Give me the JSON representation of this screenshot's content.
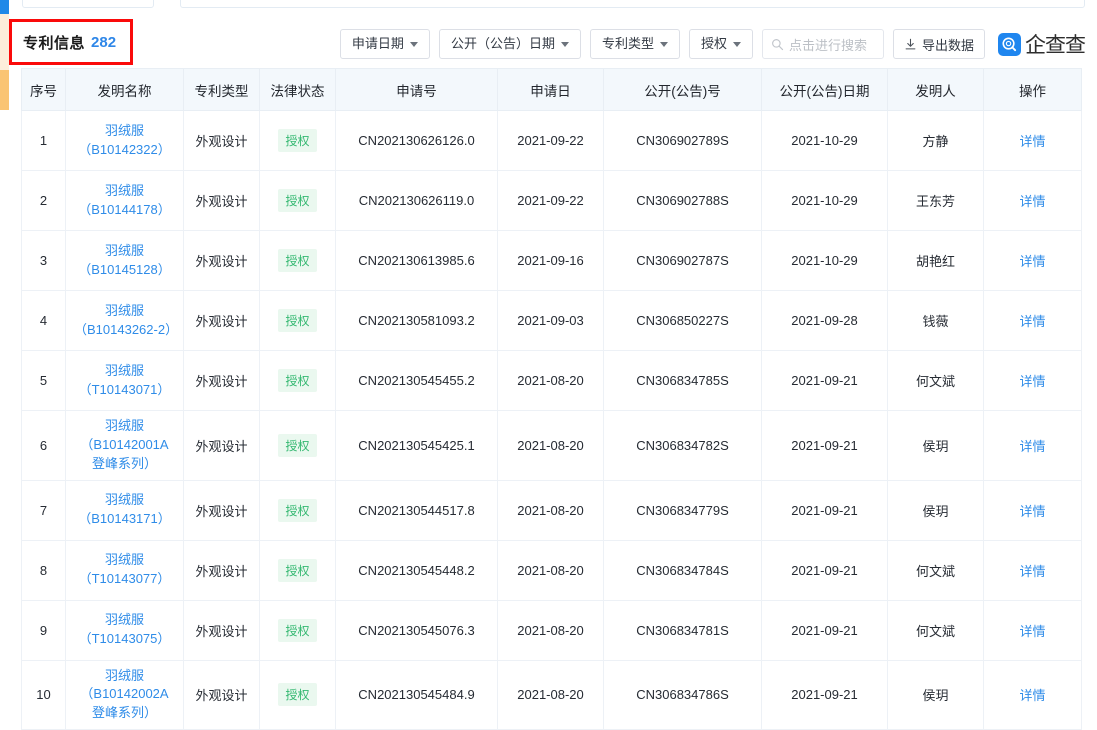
{
  "header": {
    "title_label": "专利信息",
    "count": "282"
  },
  "toolbar": {
    "filters": [
      {
        "label": "申请日期",
        "icon": "chevron-down-icon"
      },
      {
        "label": "公开（公告）日期",
        "icon": "chevron-down-icon"
      },
      {
        "label": "专利类型",
        "icon": "chevron-down-icon"
      },
      {
        "label": "授权",
        "icon": "chevron-down-icon"
      }
    ],
    "search": {
      "placeholder": "点击进行搜索",
      "icon": "search-icon"
    },
    "export": {
      "label": "导出数据",
      "icon": "download-icon"
    },
    "brand": {
      "name": "企查查",
      "icon": "qcc-logo-icon",
      "color": "#1f86ef"
    }
  },
  "table": {
    "columns": [
      "序号",
      "发明名称",
      "专利类型",
      "法律状态",
      "申请号",
      "申请日",
      "公开(公告)号",
      "公开(公告)日期",
      "发明人",
      "操作"
    ],
    "action_label": "详情",
    "rows": [
      {
        "seq": "1",
        "name": "羽绒服（B10142322）",
        "type": "外观设计",
        "status": "授权",
        "app_no": "CN202130626126.0",
        "app_date": "2021-09-22",
        "pub_no": "CN306902789S",
        "pub_date": "2021-10-29",
        "inventor": "方静"
      },
      {
        "seq": "2",
        "name": "羽绒服（B10144178）",
        "type": "外观设计",
        "status": "授权",
        "app_no": "CN202130626119.0",
        "app_date": "2021-09-22",
        "pub_no": "CN306902788S",
        "pub_date": "2021-10-29",
        "inventor": "王东芳"
      },
      {
        "seq": "3",
        "name": "羽绒服（B10145128）",
        "type": "外观设计",
        "status": "授权",
        "app_no": "CN202130613985.6",
        "app_date": "2021-09-16",
        "pub_no": "CN306902787S",
        "pub_date": "2021-10-29",
        "inventor": "胡艳红"
      },
      {
        "seq": "4",
        "name": "羽绒服（B10143262-2）",
        "type": "外观设计",
        "status": "授权",
        "app_no": "CN202130581093.2",
        "app_date": "2021-09-03",
        "pub_no": "CN306850227S",
        "pub_date": "2021-09-28",
        "inventor": "钱薇"
      },
      {
        "seq": "5",
        "name": "羽绒服（T10143071）",
        "type": "外观设计",
        "status": "授权",
        "app_no": "CN202130545455.2",
        "app_date": "2021-08-20",
        "pub_no": "CN306834785S",
        "pub_date": "2021-09-21",
        "inventor": "何文斌"
      },
      {
        "seq": "6",
        "name": "羽绒服（B10142001A登峰系列）",
        "type": "外观设计",
        "status": "授权",
        "app_no": "CN202130545425.1",
        "app_date": "2021-08-20",
        "pub_no": "CN306834782S",
        "pub_date": "2021-09-21",
        "inventor": "侯玥"
      },
      {
        "seq": "7",
        "name": "羽绒服（B10143171）",
        "type": "外观设计",
        "status": "授权",
        "app_no": "CN202130544517.8",
        "app_date": "2021-08-20",
        "pub_no": "CN306834779S",
        "pub_date": "2021-09-21",
        "inventor": "侯玥"
      },
      {
        "seq": "8",
        "name": "羽绒服（T10143077）",
        "type": "外观设计",
        "status": "授权",
        "app_no": "CN202130545448.2",
        "app_date": "2021-08-20",
        "pub_no": "CN306834784S",
        "pub_date": "2021-09-21",
        "inventor": "何文斌"
      },
      {
        "seq": "9",
        "name": "羽绒服（T10143075）",
        "type": "外观设计",
        "status": "授权",
        "app_no": "CN202130545076.3",
        "app_date": "2021-08-20",
        "pub_no": "CN306834781S",
        "pub_date": "2021-09-21",
        "inventor": "何文斌"
      },
      {
        "seq": "10",
        "name": "羽绒服（B10142002A登峰系列）",
        "type": "外观设计",
        "status": "授权",
        "app_no": "CN202130545484.9",
        "app_date": "2021-08-20",
        "pub_no": "CN306834786S",
        "pub_date": "2021-09-21",
        "inventor": "侯玥"
      }
    ]
  }
}
